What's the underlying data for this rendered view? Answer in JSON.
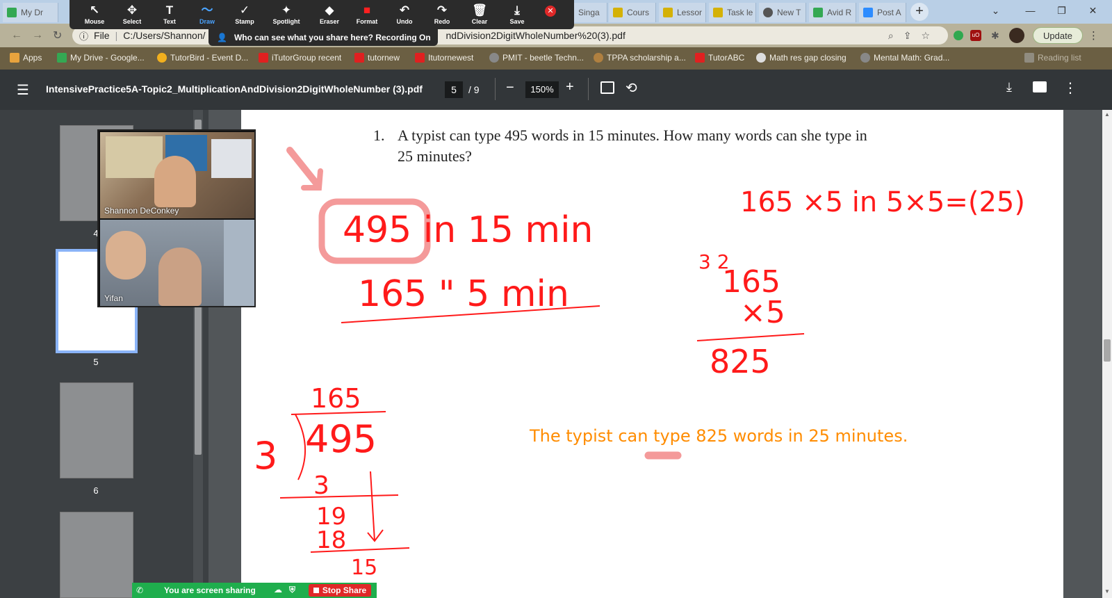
{
  "tabs": [
    {
      "label": "My Dr",
      "color": "#34a853"
    },
    {
      "label": "Singa",
      "color": "#d4b106"
    },
    {
      "label": "Cours",
      "color": "#d4b106"
    },
    {
      "label": "Lessor",
      "color": "#d4b106"
    },
    {
      "label": "Task le",
      "color": "#d4b106"
    },
    {
      "label": "New T",
      "color": "#555555"
    },
    {
      "label": "Avid R",
      "color": "#34a853"
    },
    {
      "label": "Post A",
      "color": "#2d8cff"
    }
  ],
  "zoom_toolbar": {
    "tools": [
      {
        "label": "Mouse",
        "icon": "↖"
      },
      {
        "label": "Select",
        "icon": "✥"
      },
      {
        "label": "Text",
        "icon": "T"
      },
      {
        "label": "Draw",
        "icon": "〜"
      },
      {
        "label": "Stamp",
        "icon": "✓"
      },
      {
        "label": "Spotlight",
        "icon": "✦"
      },
      {
        "label": "Eraser",
        "icon": "◆"
      },
      {
        "label": "Format",
        "icon": "■"
      },
      {
        "label": "Undo",
        "icon": "↶"
      },
      {
        "label": "Redo",
        "icon": "↷"
      },
      {
        "label": "Clear",
        "icon": "🗑"
      },
      {
        "label": "Save",
        "icon": "⤓"
      }
    ],
    "recording_notice": "Who can see what you share here? Recording On"
  },
  "address": {
    "file_label": "File",
    "url_start": "C:/Users/Shannon/",
    "url_end": "ndDivision2DigitWholeNumber%20(3).pdf",
    "update_label": "Update"
  },
  "bookmarks": [
    {
      "label": "Apps",
      "color": "#e8a33d"
    },
    {
      "label": "My Drive - Google...",
      "color": "#34a853"
    },
    {
      "label": "TutorBird - Event D...",
      "color": "#f2b01e"
    },
    {
      "label": "iTutorGroup recent",
      "color": "#e02020"
    },
    {
      "label": "tutornew",
      "color": "#e02020"
    },
    {
      "label": "Itutornewest",
      "color": "#e02020"
    },
    {
      "label": "PMIT - beetle Techn...",
      "color": "#888888"
    },
    {
      "label": "TPPA scholarship a...",
      "color": "#b08040"
    },
    {
      "label": "TutorABC",
      "color": "#e02020"
    },
    {
      "label": "Math res gap closing",
      "color": "#dddddd"
    },
    {
      "label": "Mental Math: Grad...",
      "color": "#888888"
    },
    {
      "label": "Reading list",
      "color": "#aaaaaa"
    }
  ],
  "pdf": {
    "filename": "IntensivePractice5A-Topic2_MultiplicationAndDivision2DigitWholeNumber (3).pdf",
    "current_page": "5",
    "total_pages": "/ 9",
    "zoom": "150%"
  },
  "sidebar": {
    "thumb_labels": [
      "4",
      "5",
      "6"
    ]
  },
  "question": {
    "number": "1.",
    "line1": "A typist can type 495 words in 15 minutes. How many words can she type in",
    "line2": "25 minutes?"
  },
  "answer_text": "The typist can type 825 words in 25 minutes.",
  "handwriting": {
    "line1": "495 in 15 min",
    "line2": "165 \" 5 min",
    "top_right": "165 ×5 in 5×5=(25)",
    "mult_carry": "3  2",
    "mult_top": "165",
    "mult_factor": "×5",
    "mult_result": "825",
    "div_quotient": "165",
    "div_divisor": "3",
    "div_dividend": "495",
    "div_step1": "3",
    "div_step2": "19",
    "div_step3": "18",
    "div_step4": "15"
  },
  "videos": [
    {
      "name": "Shannon DeConkey"
    },
    {
      "name": "Yifan"
    }
  ],
  "share_bar": {
    "status": "You are screen sharing",
    "stop_label": "Stop Share"
  }
}
